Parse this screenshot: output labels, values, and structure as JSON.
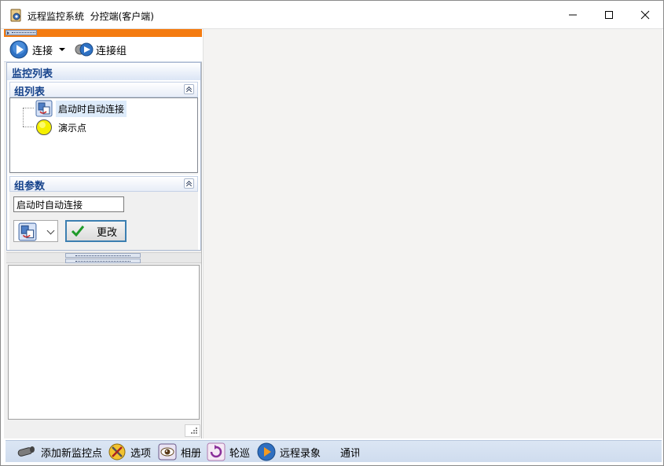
{
  "window": {
    "title": "远程监控系统  分控端(客户端)"
  },
  "toolbar": {
    "connect_label": "连接",
    "connect_group_label": "连接组"
  },
  "monitor_panel": {
    "title": "监控列表",
    "group_list": {
      "title": "组列表",
      "items": [
        {
          "label": "启动时自动连接",
          "icon": "group-icon",
          "selected": true
        },
        {
          "label": "演示点",
          "icon": "yellow-dot-icon",
          "selected": false
        }
      ]
    },
    "group_params": {
      "title": "组参数",
      "name_value": "启动时自动连接",
      "change_label": "更改"
    }
  },
  "bottom_toolbar": {
    "items": [
      {
        "label": "添加新监控点",
        "icon": "camera-icon"
      },
      {
        "label": "选项",
        "icon": "tools-icon"
      },
      {
        "label": "相册",
        "icon": "eye-icon"
      },
      {
        "label": "轮巡",
        "icon": "cycle-icon"
      },
      {
        "label": "远程录象",
        "icon": "record-icon"
      },
      {
        "label": "通讯",
        "icon": ""
      }
    ]
  },
  "colors": {
    "accent_orange": "#f47b10",
    "header_blue": "#15428b",
    "bottom_bar": "#dbe6f4"
  }
}
